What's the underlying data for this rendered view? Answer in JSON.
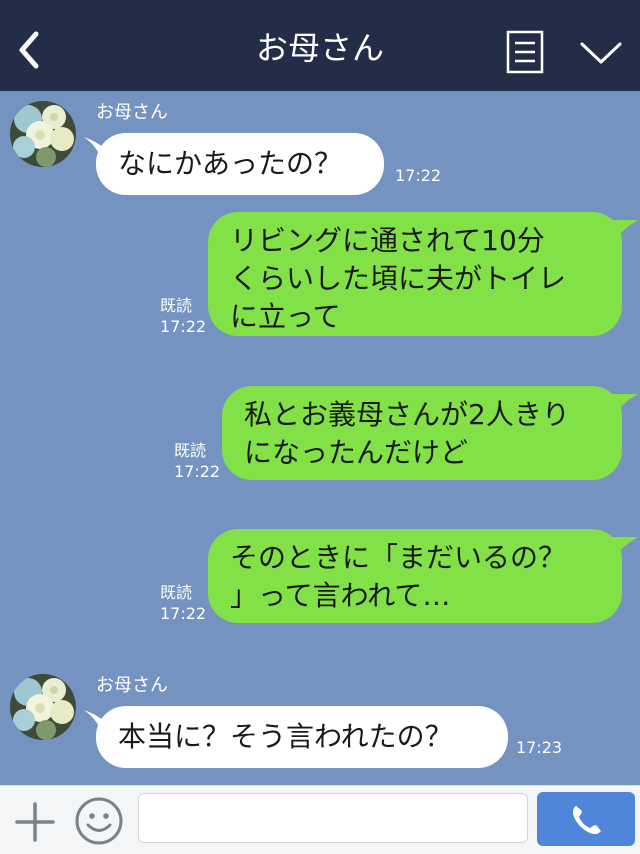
{
  "header": {
    "title": "お母さん",
    "back_icon": "chevron-left-icon",
    "menu_icon": "list-icon",
    "expand_icon": "chevron-down-icon"
  },
  "messages": [
    {
      "side": "left",
      "sender": "お母さん",
      "text": "なにかあったの？",
      "time": "17:22"
    },
    {
      "side": "right",
      "text": "リビングに通されて10分\nくらいした頃に夫がトイレ\nに立って",
      "read": "既読",
      "time": "17:22"
    },
    {
      "side": "right",
      "text": "私とお義母さんが2人きり\nになったんだけど",
      "read": "既読",
      "time": "17:22"
    },
    {
      "side": "right",
      "text": "そのときに「まだいるの？\n」って言われて…",
      "read": "既読",
      "time": "17:22"
    },
    {
      "side": "left",
      "sender": "お母さん",
      "text": "本当に？そう言われたの？",
      "time": "17:23"
    }
  ],
  "footer": {
    "input_value": "",
    "plus_icon": "plus-icon",
    "emoji_icon": "smiley-icon",
    "call_icon": "phone-icon"
  },
  "colors": {
    "header_bg": "#232d48",
    "chat_bg": "#7493c1",
    "sent_bubble": "#82e147",
    "received_bubble": "#ffffff",
    "call_button": "#4f86d9"
  }
}
